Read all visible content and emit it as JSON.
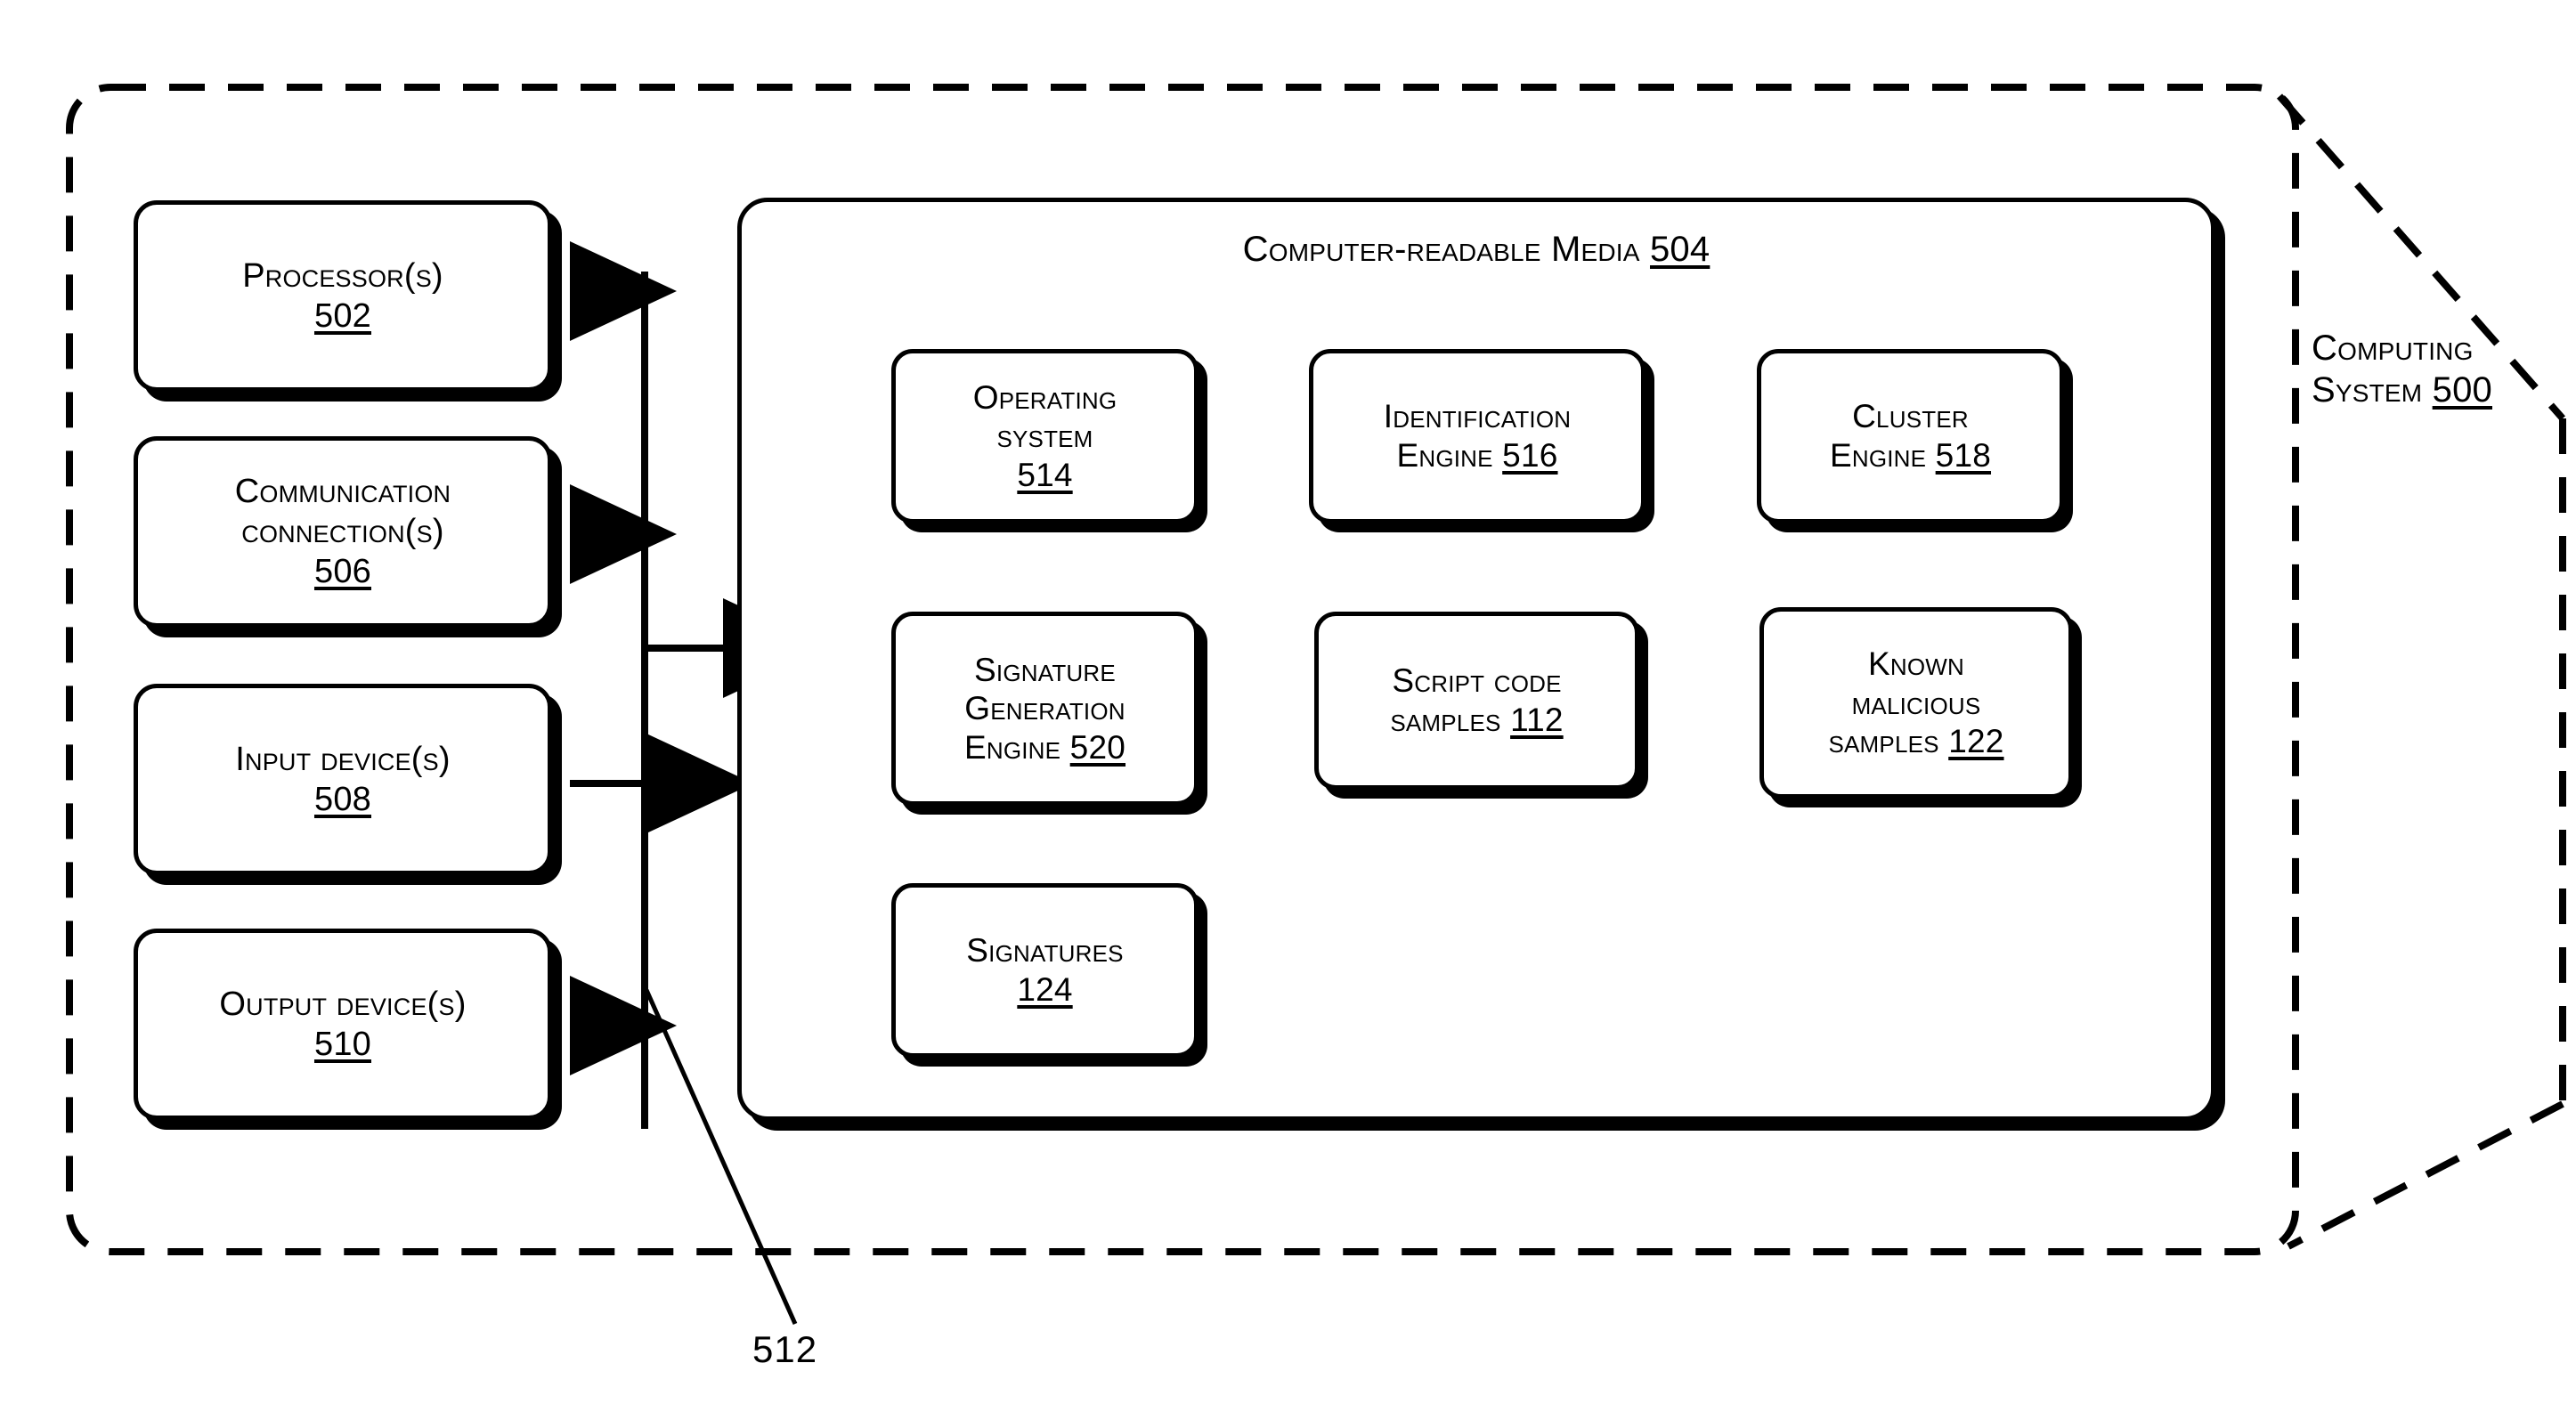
{
  "figure": {
    "system_label": {
      "text": "Computing\nSystem ",
      "numeral": "500"
    },
    "bus_numeral": "512"
  },
  "hardware_blocks": [
    {
      "name": "processor",
      "text": "Processor(s)\n",
      "numeral": "502"
    },
    {
      "name": "communication-connection",
      "text": "Communication\nconnection(s)\n",
      "numeral": "506"
    },
    {
      "name": "input-device",
      "text": "Input device(s)\n",
      "numeral": "508"
    },
    {
      "name": "output-device",
      "text": "Output device(s)\n",
      "numeral": "510"
    }
  ],
  "computer_readable_media": {
    "title_text": "Computer-readable Media ",
    "title_numeral": "504",
    "modules": [
      {
        "name": "operating-system",
        "text": "Operating\nsystem\n",
        "numeral": "514"
      },
      {
        "name": "identification-engine",
        "text": "Identification\nEngine ",
        "numeral": "516"
      },
      {
        "name": "cluster-engine",
        "text": "Cluster\nEngine ",
        "numeral": "518"
      },
      {
        "name": "signature-generation-engine",
        "text": "Signature\nGeneration\nEngine ",
        "numeral": "520"
      },
      {
        "name": "script-code-samples",
        "text": "Script code\nsamples ",
        "numeral": "112"
      },
      {
        "name": "known-malicious-samples",
        "text": "Known\nmalicious\nsamples ",
        "numeral": "122"
      },
      {
        "name": "signatures",
        "text": "Signatures\n",
        "numeral": "124"
      }
    ]
  },
  "colors": {
    "stroke": "#000000",
    "background": "#ffffff"
  }
}
